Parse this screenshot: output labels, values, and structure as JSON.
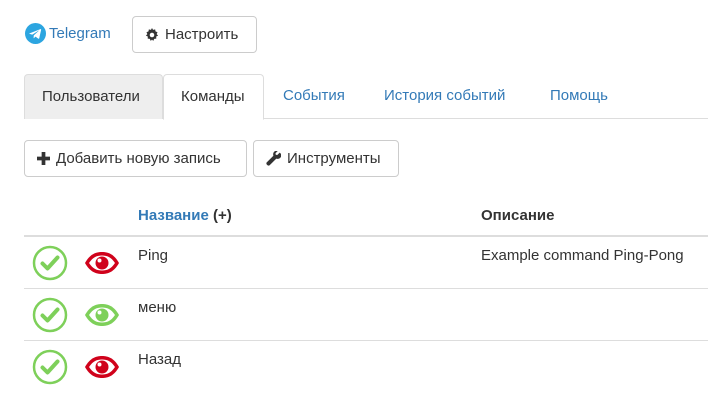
{
  "header": {
    "telegram_label": "Telegram",
    "settings_label": "Настроить"
  },
  "tabs": [
    {
      "label": "Пользователи",
      "state": "inactive-gray"
    },
    {
      "label": "Команды",
      "state": "active"
    },
    {
      "label": "События",
      "state": "link"
    },
    {
      "label": "История событий",
      "state": "link"
    },
    {
      "label": "Помощь",
      "state": "link"
    }
  ],
  "toolbar": {
    "add_label": "Добавить новую запись",
    "tools_label": "Инструменты"
  },
  "table": {
    "columns": {
      "name": "Название",
      "name_suffix": "(+)",
      "description": "Описание"
    },
    "rows": [
      {
        "name": "Ping",
        "description": "Example command Ping-Pong",
        "enabled_icon": "check-circle-icon",
        "visibility_icon": "eye-red-icon"
      },
      {
        "name": "меню",
        "description": "",
        "enabled_icon": "check-circle-icon",
        "visibility_icon": "eye-green-icon"
      },
      {
        "name": "Назад",
        "description": "",
        "enabled_icon": "check-circle-icon",
        "visibility_icon": "eye-red-icon"
      }
    ]
  },
  "colors": {
    "link": "#337ab7",
    "check_green": "#7ed05a",
    "eye_red": "#d0021b",
    "eye_green": "#7ed05a",
    "telegram_blue": "#2ca5e0"
  }
}
